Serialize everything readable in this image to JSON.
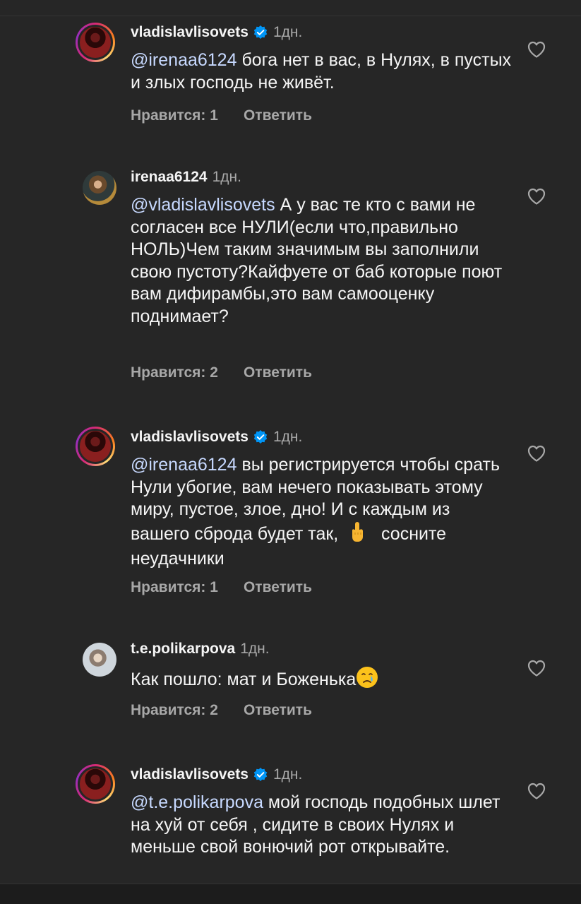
{
  "comments": [
    {
      "username": "vladislavlisovets",
      "verified": true,
      "time": "1дн.",
      "mention": "@irenaa6124",
      "text": " бога нет в вас, в Нулях, в пустых и злых господь  не живёт.",
      "likes_label": "Нравится: 1",
      "reply_label": "Ответить"
    },
    {
      "username": "irenaa6124",
      "verified": false,
      "time": "1дн.",
      "mention": "@vladislavlisovets",
      "text": " А у вас  те кто с вами не согласен все НУЛИ(если что,правильно НОЛЬ)Чем таким значимым вы заполнили свою пустоту?Кайфуете от баб которые поют вам дифирамбы,это вам самооценку поднимает?",
      "likes_label": "Нравится: 2",
      "reply_label": "Ответить"
    },
    {
      "username": "vladislavlisovets",
      "verified": true,
      "time": "1дн.",
      "mention": "@irenaa6124",
      "text": " вы регистрируется чтобы срать Нули убогие, вам нечего показывать этому миру, пустое, злое, дно! И с каждым из вашего сброда будет так,",
      "text_after": "сосните неудачники",
      "likes_label": "Нравится: 1",
      "reply_label": "Ответить"
    },
    {
      "username": "t.e.polikarpova",
      "verified": false,
      "time": "1дн.",
      "mention": "",
      "text": "Как пошло: мат и Боженька",
      "likes_label": "Нравится: 2",
      "reply_label": "Ответить"
    },
    {
      "username": "vladislavlisovets",
      "verified": true,
      "time": "1дн.",
      "mention": "@t.e.polikarpova",
      "text": " мой господь подобных шлет на хуй от себя , сидите в своих Нулях и меньше свой вонючий рот открывайте."
    }
  ],
  "icons": {
    "heart": "heart-outline-icon",
    "verified": "verified-badge-icon",
    "middle_finger": "middle-finger-emoji",
    "crying": "crying-face-emoji"
  },
  "colors": {
    "background": "#262626",
    "text": "#f5f5f5",
    "secondary": "#a8a8a8",
    "verified": "#0095f6",
    "mention": "#c7d9ff"
  }
}
